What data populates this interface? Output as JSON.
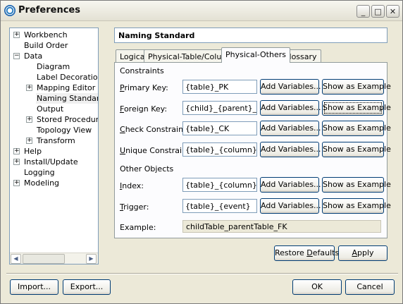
{
  "window": {
    "title": "Preferences"
  },
  "titlebar_buttons": {
    "minimize": "_",
    "maximize": "□",
    "close": "✕"
  },
  "tree": {
    "items": [
      {
        "label": "Workbench",
        "expander": "+"
      },
      {
        "label": "Build Order",
        "expander": ""
      },
      {
        "label": "Data",
        "expander": "−"
      },
      {
        "label": "Diagram",
        "expander": ""
      },
      {
        "label": "Label Decorations",
        "expander": ""
      },
      {
        "label": "Mapping Editor",
        "expander": "+"
      },
      {
        "label": "Naming Standard",
        "expander": ""
      },
      {
        "label": "Output",
        "expander": ""
      },
      {
        "label": "Stored Procedures a",
        "expander": "+"
      },
      {
        "label": "Topology View",
        "expander": ""
      },
      {
        "label": "Transform",
        "expander": "+"
      },
      {
        "label": "Help",
        "expander": "+"
      },
      {
        "label": "Install/Update",
        "expander": "+"
      },
      {
        "label": "Logging",
        "expander": ""
      },
      {
        "label": "Modeling",
        "expander": "+"
      }
    ],
    "scroll_left": "◀",
    "scroll_right": "▶"
  },
  "page_title": "Naming Standard",
  "tabs": [
    {
      "label": "Logical"
    },
    {
      "label": "Physical-Table/Column"
    },
    {
      "label": "Physical-Others"
    },
    {
      "label": "Glossary"
    }
  ],
  "constraints": {
    "heading": "Constraints",
    "rows": [
      {
        "label_key": "P",
        "label_rest": "rimary Key:",
        "value": "{table}_PK"
      },
      {
        "label_key": "F",
        "label_rest": "oreign Key:",
        "value": "{child}_{parent}_FK"
      },
      {
        "label_key": "C",
        "label_rest": "heck Constraint:",
        "value": "{table}_CK"
      },
      {
        "label_key": "U",
        "label_rest": "nique Constraint:",
        "value": "{table}_{column}_UN"
      }
    ]
  },
  "other_objects": {
    "heading": "Other Objects",
    "rows": [
      {
        "label_key": "I",
        "label_rest": "ndex:",
        "value": "{table}_{column}_IDX"
      },
      {
        "label_key": "T",
        "label_rest": "rigger:",
        "value": "{table}_{event}"
      }
    ]
  },
  "add_variables_label": "Add Variables...",
  "show_example_label": "Show as Example",
  "example": {
    "label": "Example:",
    "value": "childTable_parentTable_FK"
  },
  "restore_defaults_pre": "Restore ",
  "restore_defaults_key": "D",
  "restore_defaults_post": "efaults",
  "apply_pre": "",
  "apply_key": "A",
  "apply_post": "pply",
  "import_label": "Import...",
  "export_label": "Export...",
  "ok_label": "OK",
  "cancel_label": "Cancel"
}
